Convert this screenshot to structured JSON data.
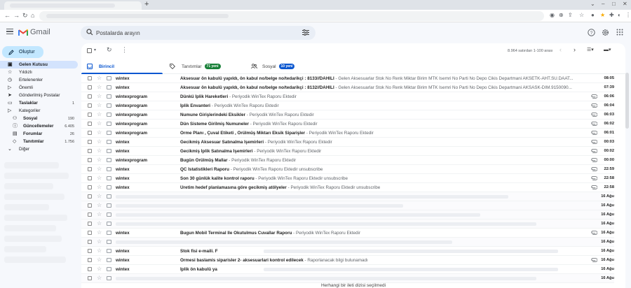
{
  "browser": {
    "tab_title": "",
    "new_tab_label": "+",
    "address": ""
  },
  "gmail": {
    "app_name": "Gmail",
    "search_placeholder": "Postalarda arayın",
    "compose_label": "Oluştur",
    "nav": [
      {
        "label": "Gelen Kutusu",
        "count": "",
        "icon": "inbox-icon",
        "active": true,
        "sub": false,
        "bold": true
      },
      {
        "label": "Yıldızlı",
        "count": "",
        "icon": "star-icon",
        "active": false,
        "sub": false,
        "bold": false
      },
      {
        "label": "Ertelenenler",
        "count": "",
        "icon": "clock-icon",
        "active": false,
        "sub": false,
        "bold": false
      },
      {
        "label": "Önemli",
        "count": "",
        "icon": "important-icon",
        "active": false,
        "sub": false,
        "bold": false
      },
      {
        "label": "Gönderilmiş Postalar",
        "count": "",
        "icon": "send-icon",
        "active": false,
        "sub": false,
        "bold": false
      },
      {
        "label": "Taslaklar",
        "count": "1",
        "icon": "draft-icon",
        "active": false,
        "sub": false,
        "bold": true
      },
      {
        "label": "Kategoriler",
        "count": "",
        "icon": "label-icon",
        "active": false,
        "sub": false,
        "bold": false
      },
      {
        "label": "Sosyal",
        "count": "190",
        "icon": "people-icon",
        "active": false,
        "sub": true,
        "bold": true
      },
      {
        "label": "Güncellemeler",
        "count": "6.405",
        "icon": "info-icon",
        "active": false,
        "sub": true,
        "bold": true
      },
      {
        "label": "Forumlar",
        "count": "26",
        "icon": "forum-icon",
        "active": false,
        "sub": true,
        "bold": true
      },
      {
        "label": "Tanıtımlar",
        "count": "1.756",
        "icon": "tag-icon",
        "active": false,
        "sub": true,
        "bold": true
      },
      {
        "label": "Diğer",
        "count": "",
        "icon": "chevron-down-icon",
        "active": false,
        "sub": false,
        "bold": false
      }
    ],
    "pagination": "8.964 satırdan 1-100 arası",
    "tabs": [
      {
        "label": "Birincil",
        "badge": "",
        "badge_color": ""
      },
      {
        "label": "Tanıtımlar",
        "badge": "71 yeni",
        "badge_color": "#188038"
      },
      {
        "label": "Sosyal",
        "badge": "10 yeni",
        "badge_color": "#0b57d0"
      }
    ],
    "emails": [
      {
        "sender": "wintex",
        "subject": "Aksesuar ön kabulü yapıldı, ön kabul no/belge no/tedarikçi : 8133//DAHILI",
        "snippet": " - Gelen Aksesuarlar Stok No Renk Miktar Birim MTK Isemri No Parti No Depo Cikis Departmani AKSETK-AHT.SU.DAAT...",
        "date": "08:05",
        "attachment": false
      },
      {
        "sender": "wintex",
        "subject": "Aksesuar ön kabulü yapıldı, ön kabul no/belge no/tedarikçi : 8132//DAHILI",
        "snippet": " - Gelen Aksesuarlar Stok No Renk Miktar Birim MTK Isemri No Parti No Depo Cikis Departmani AKSASK-DIM.9150090...",
        "date": "07:39",
        "attachment": false
      },
      {
        "sender": "wintexprogram",
        "subject": "Dünkü İplik Hareketleri",
        "snippet": " - Periyodik WinTex Raporu Ektedir",
        "date": "06:06",
        "attachment": true
      },
      {
        "sender": "wintexprogram",
        "subject": "İplik Envanteri",
        "snippet": " - Periyodik WinTex Raporu Ektedir",
        "date": "06:04",
        "attachment": true
      },
      {
        "sender": "wintexprogram",
        "subject": "Numune Girişlerindeki Eksikler",
        "snippet": " - Periyodik WinTex Raporu Ektedir",
        "date": "06:03",
        "attachment": true
      },
      {
        "sender": "wintexprogram",
        "subject": "Dün Sisteme Girilmiş Numuneler",
        "snippet": " - Periyodik WinTex Raporu Ektedir",
        "date": "06:02",
        "attachment": true
      },
      {
        "sender": "wintexprogram",
        "subject": "Örme Planı , Çuval Etiketi , Örülmüş Miktarı Eksik Siparişler",
        "snippet": " - Periyodik WinTex Raporu Ektedir",
        "date": "06:01",
        "attachment": true
      },
      {
        "sender": "wintex",
        "subject": "Gecikmiş Aksesuar Satınalma İşemirleri",
        "snippet": " - Periyodik WinTex Raporu Ektedir",
        "date": "00:03",
        "attachment": true
      },
      {
        "sender": "wintex",
        "subject": "Gecikmiş İplik Satınalma İşemirleri",
        "snippet": " - Periyodik WinTex Raporu Ektedir",
        "date": "00:02",
        "attachment": true
      },
      {
        "sender": "wintexprogram",
        "subject": "Bugün Örülmüş Mallar",
        "snippet": " - Periyodik WinTex Raporu Ektedir",
        "date": "00:00",
        "attachment": true
      },
      {
        "sender": "wintex",
        "subject": "QC İstatistikleri Raporu",
        "snippet": " - Periyodik WinTex Raporu Ektedir unsubscribe",
        "date": "22:59",
        "attachment": true
      },
      {
        "sender": "wintex",
        "subject": "Son 30 günlük kalite kontrol raporu",
        "snippet": " - Periyodik WinTex Raporu Ektedir unsubscribe",
        "date": "22:58",
        "attachment": true
      },
      {
        "sender": "wintex",
        "subject": "Üretim hedef planlamasına göre gecikmiş atölyeler",
        "snippet": " - Periyodik WinTex Raporu Ektedir unsubscribe",
        "date": "22:58",
        "attachment": true
      },
      {
        "sender": "",
        "subject": "",
        "snippet": "",
        "date": "16 Ağu",
        "attachment": false
      },
      {
        "sender": "",
        "subject": "",
        "snippet": "",
        "date": "16 Ağu",
        "attachment": false
      },
      {
        "sender": "",
        "subject": "",
        "snippet": "",
        "date": "16 Ağu",
        "attachment": false
      },
      {
        "sender": "",
        "subject": "",
        "snippet": "",
        "date": "16 Ağu",
        "attachment": false
      },
      {
        "sender": "wintex",
        "subject": "Bugun Mobil Terminal Ile Okutulmus Cuvallar Raporu",
        "snippet": " - Periyodik WinTex Raporu Ektedir",
        "date": "16 Ağu",
        "attachment": true
      },
      {
        "sender": "",
        "subject": "",
        "snippet": "",
        "date": "16 Ağu",
        "attachment": false
      },
      {
        "sender": "wintex",
        "subject": "Stok fisi e-maili. F",
        "snippet": "",
        "date": "16 Ağu",
        "attachment": false
      },
      {
        "sender": "wintex",
        "subject": "Örmesi baslamis siparisler 2- aksesuarlari kontrol edilecek",
        "snippet": " - Raporlanacak bilgi bulunamadı",
        "date": "16 Ağu",
        "attachment": true
      },
      {
        "sender": "wintex",
        "subject": "İplik ön kabulü ya",
        "snippet": "",
        "date": "16 Ağu",
        "attachment": false
      },
      {
        "sender": "",
        "subject": "",
        "snippet": "",
        "date": "16 Ağu",
        "attachment": false
      }
    ],
    "empty_message": "Herhangi bir ileti dizisi seçilmedi"
  },
  "colors": {
    "accent": "#0b57d0",
    "compose_bg": "#c2e7ff",
    "active_nav_bg": "#d3e3fd",
    "background": "#f6f8fc"
  }
}
